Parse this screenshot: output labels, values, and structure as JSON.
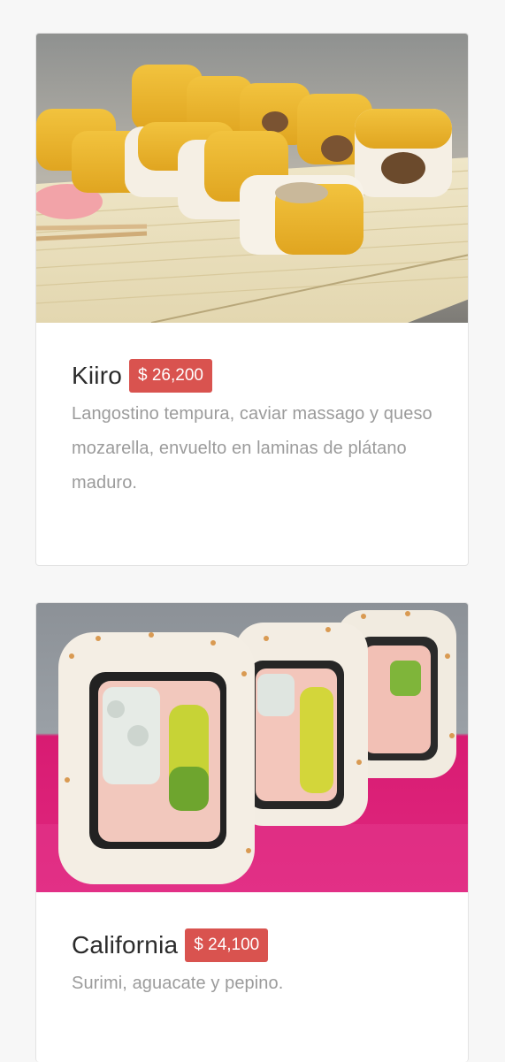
{
  "menu": {
    "items": [
      {
        "name": "Kiiro",
        "price": "$ 26,200",
        "description": "Langostino tempura, caviar massago y queso mozarella, envuelto en laminas de plátano maduro.",
        "image_icon": "sushi-roll-plantain-photo"
      },
      {
        "name": "California",
        "price": "$ 24,100",
        "description": "Surimi, aguacate y pepino.",
        "image_icon": "california-roll-photo"
      }
    ]
  },
  "colors": {
    "price_badge": "#d9534f",
    "description_text": "#9b9b9b",
    "title_text": "#2b2b2b"
  }
}
